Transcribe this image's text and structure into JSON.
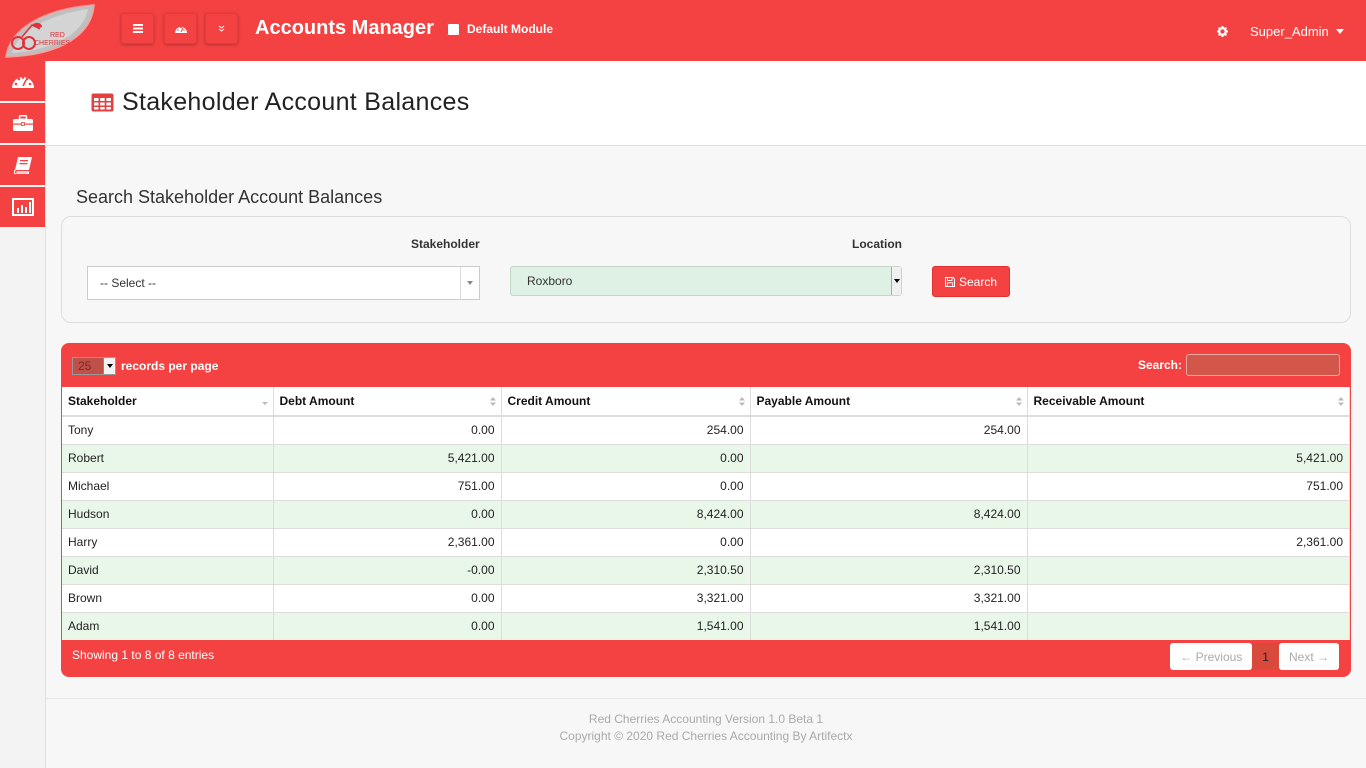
{
  "header": {
    "logo_text": "RED CHERRIES",
    "app_title": "Accounts Manager",
    "default_module_label": "Default Module",
    "default_module_checked": false,
    "user_name": "Super_Admin",
    "icons": [
      "menu-icon",
      "dashboard-icon",
      "chevron-double-down-icon",
      "gear-icon"
    ]
  },
  "sidebar": {
    "items": [
      {
        "name": "dashboard",
        "icon": "dashboard-icon"
      },
      {
        "name": "briefcase",
        "icon": "briefcase-icon"
      },
      {
        "name": "book",
        "icon": "book-icon"
      },
      {
        "name": "reports",
        "icon": "bar-chart-icon"
      }
    ]
  },
  "page": {
    "title": "Stakeholder Account Balances",
    "title_icon": "table-icon",
    "section_title": "Search Stakeholder Account Balances"
  },
  "search": {
    "stakeholder_label": "Stakeholder",
    "stakeholder_value": "-- Select --",
    "location_label": "Location",
    "location_value": "Roxboro",
    "search_button": "Search"
  },
  "table": {
    "records_per_page_value": "25",
    "records_per_page_label": "records per page",
    "search_label": "Search:",
    "search_value": "",
    "columns": [
      "Stakeholder",
      "Debt Amount",
      "Credit Amount",
      "Payable Amount",
      "Receivable Amount"
    ],
    "rows": [
      [
        "Tony",
        "0.00",
        "254.00",
        "254.00",
        ""
      ],
      [
        "Robert",
        "5,421.00",
        "0.00",
        "",
        "5,421.00"
      ],
      [
        "Michael",
        "751.00",
        "0.00",
        "",
        "751.00"
      ],
      [
        "Hudson",
        "0.00",
        "8,424.00",
        "8,424.00",
        ""
      ],
      [
        "Harry",
        "2,361.00",
        "0.00",
        "",
        "2,361.00"
      ],
      [
        "David",
        "-0.00",
        "2,310.50",
        "2,310.50",
        ""
      ],
      [
        "Brown",
        "0.00",
        "3,321.00",
        "3,321.00",
        ""
      ],
      [
        "Adam",
        "0.00",
        "1,541.00",
        "1,541.00",
        ""
      ]
    ],
    "info": "Showing 1 to 8 of 8 entries",
    "pagination": {
      "previous": "← Previous",
      "current": "1",
      "next": "Next →"
    }
  },
  "footer": {
    "line1": "Red Cherries Accounting Version 1.0 Beta 1",
    "line2": "Copyright © 2020 Red Cherries Accounting By Artifectx"
  },
  "colors": {
    "brand": "#f44242",
    "row_alt": "#e9f7e8",
    "location_bg": "#dff0e4"
  }
}
